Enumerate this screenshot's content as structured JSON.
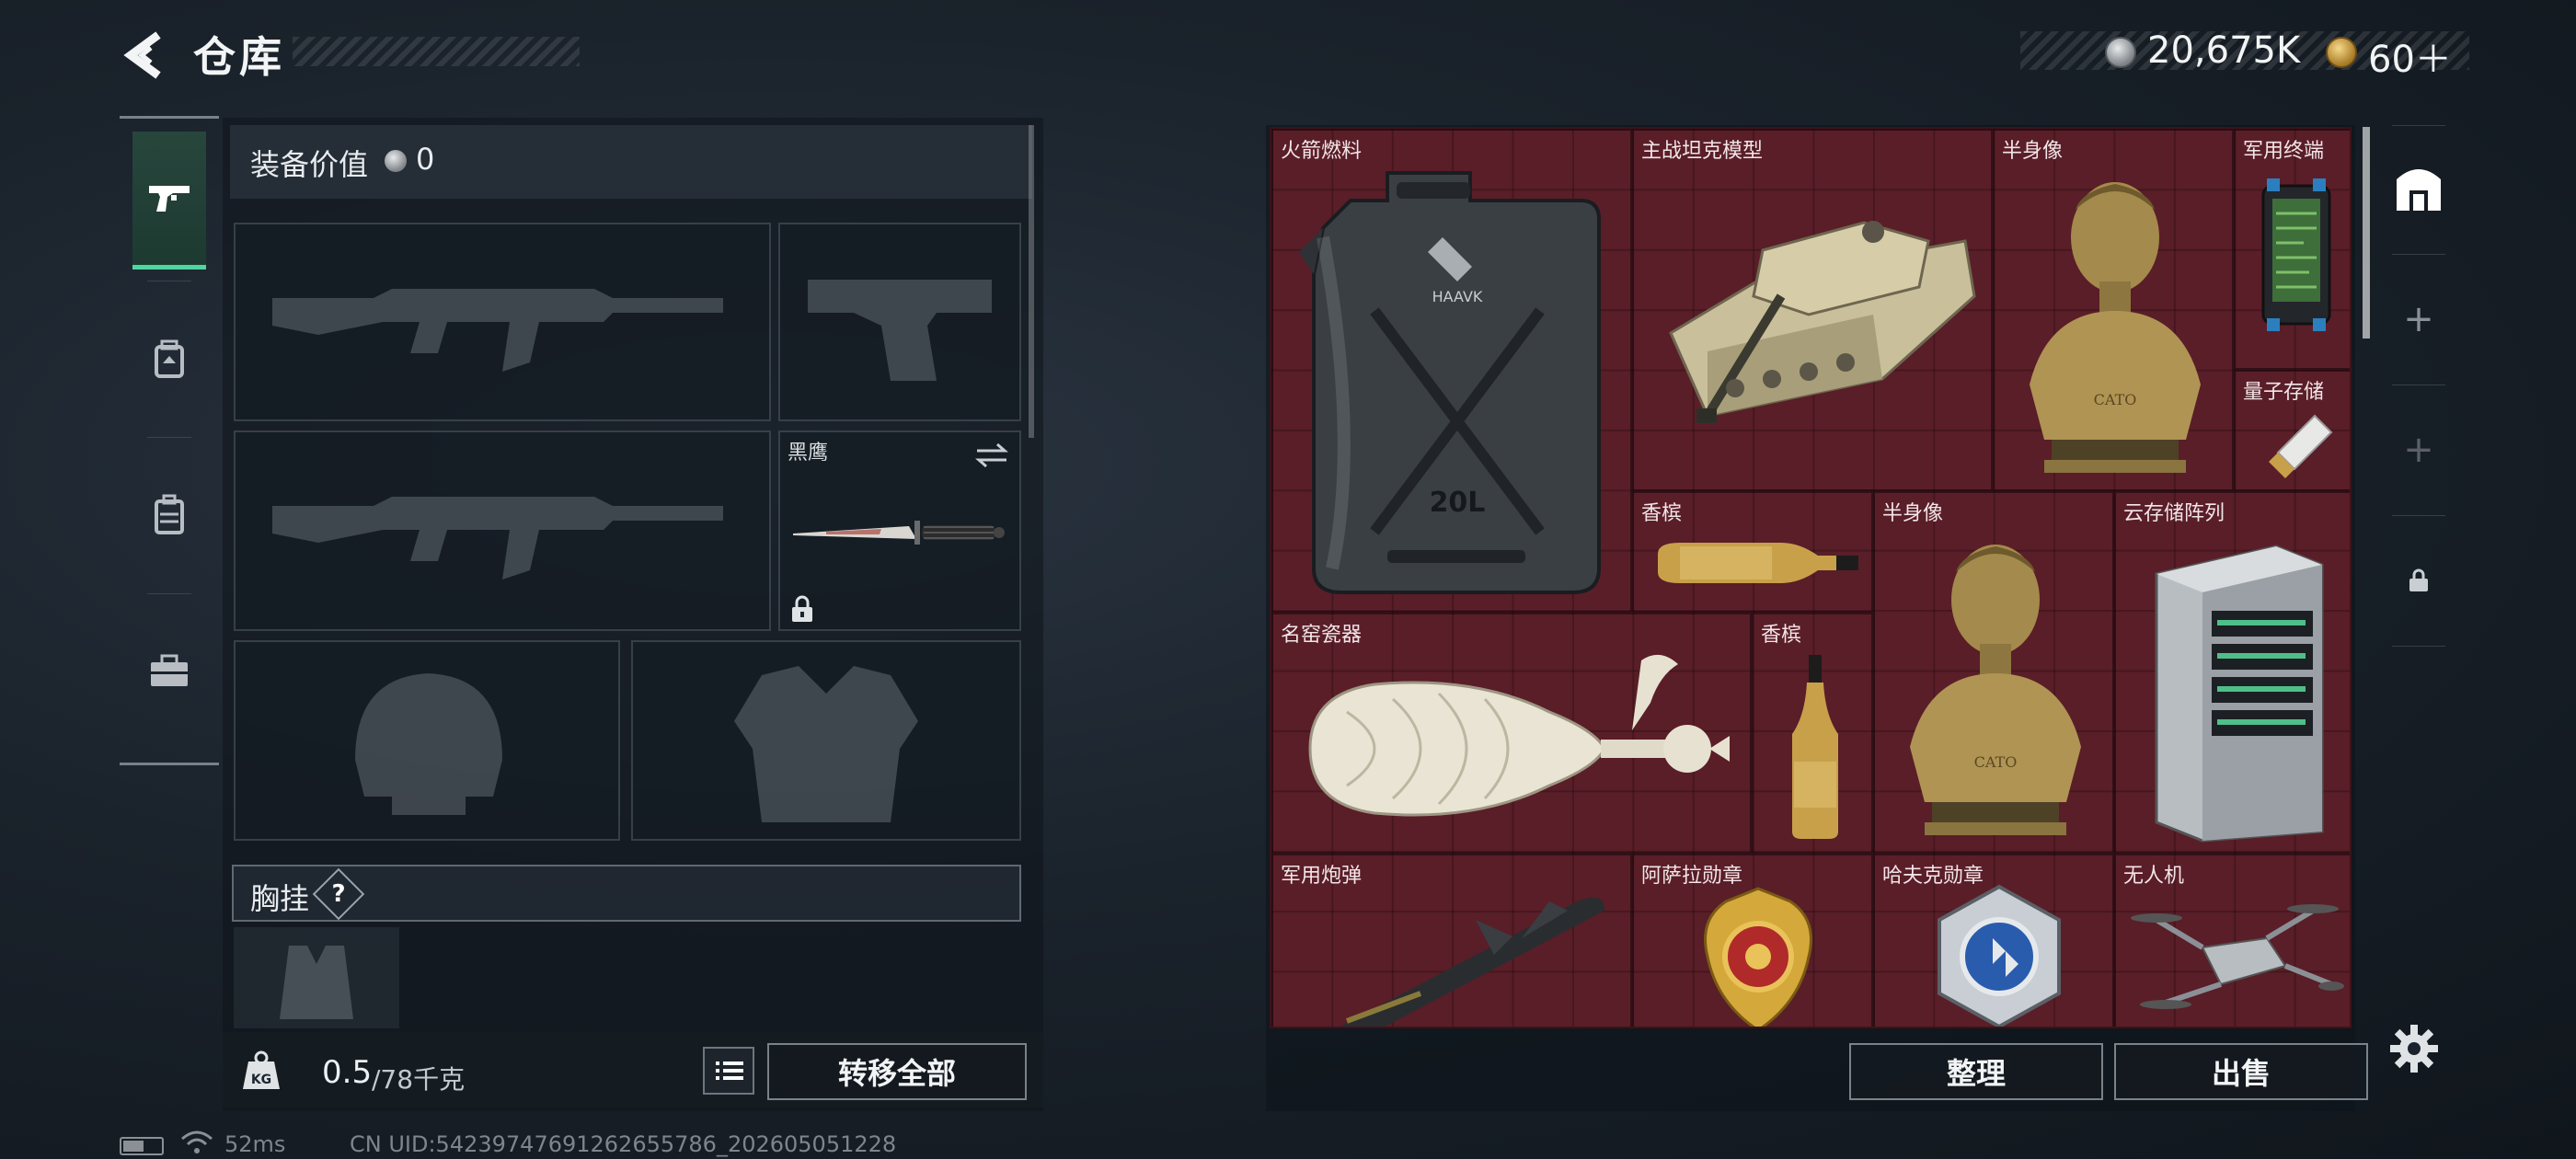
{
  "header": {
    "title": "仓库",
    "currency": [
      {
        "icon": "silver-coin-icon",
        "value": "20,675K"
      },
      {
        "icon": "gold-coin-icon",
        "value": "60＋"
      }
    ]
  },
  "left_tabs": [
    {
      "name": "tab-weapons",
      "icon": "pistol-icon",
      "active": true
    },
    {
      "name": "tab-armor",
      "icon": "armor-bag-icon",
      "active": false
    },
    {
      "name": "tab-backpack",
      "icon": "backpack-icon",
      "active": false
    },
    {
      "name": "tab-toolbox",
      "icon": "toolbox-icon",
      "active": false
    }
  ],
  "equipment": {
    "value_label": "装备价值",
    "value": "0",
    "knife_label": "黑鹰",
    "chest_label": "胸挂",
    "chest_help": "?",
    "weight_current": "0.5",
    "weight_rest": "/78千克",
    "transfer_all": "转移全部"
  },
  "stash": {
    "items": [
      {
        "name": "火箭燃料",
        "icon": "fuel-jerrycan-icon"
      },
      {
        "name": "主战坦克模型",
        "icon": "tank-model-icon"
      },
      {
        "name": "半身像",
        "icon": "bust-statue-icon"
      },
      {
        "name": "军用终端",
        "icon": "military-terminal-icon"
      },
      {
        "name": "量子存储",
        "icon": "usb-drive-icon"
      },
      {
        "name": "香槟",
        "icon": "champagne-bottle-icon"
      },
      {
        "name": "半身像",
        "icon": "bust-statue-icon"
      },
      {
        "name": "云存储阵列",
        "icon": "server-array-icon"
      },
      {
        "name": "名窑瓷器",
        "icon": "porcelain-vase-icon"
      },
      {
        "name": "香槟",
        "icon": "champagne-bottle-icon"
      },
      {
        "name": "军用炮弹",
        "icon": "missile-icon"
      },
      {
        "name": "阿萨拉勋章",
        "icon": "medal-icon"
      },
      {
        "name": "哈夫克勋章",
        "icon": "badge-icon"
      },
      {
        "name": "无人机",
        "icon": "drone-icon"
      }
    ],
    "jerrycan_text": "20L",
    "jerrycan_brand": "HAAVK",
    "bust_text": "CATO",
    "sort": "整理",
    "sell": "出售"
  },
  "right_rail": [
    {
      "icon": "stash-home-icon"
    },
    {
      "icon": "plus-icon"
    },
    {
      "icon": "plus-icon"
    },
    {
      "icon": "lock-icon"
    }
  ],
  "status": {
    "ping": "52ms",
    "uid": "CN UID:5423974769126265578​6_202605051228"
  },
  "colors": {
    "stash_bg": "#5a1e28",
    "active_tab_accent": "#4fd6a0"
  }
}
